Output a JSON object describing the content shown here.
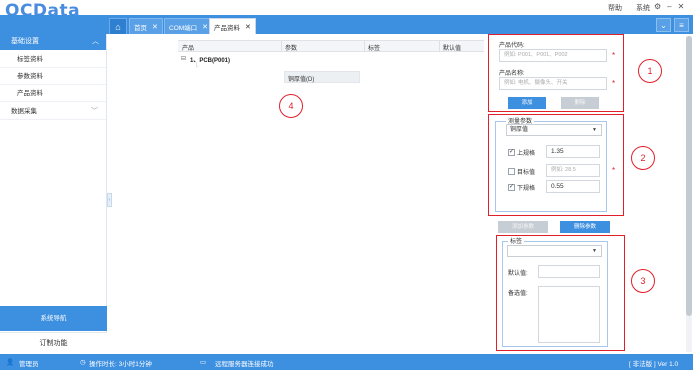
{
  "app": {
    "logo": "QCData",
    "top_links": [
      "帮助",
      "系统"
    ],
    "window_buttons": [
      "⚙",
      "–",
      "✕"
    ]
  },
  "tabs": [
    {
      "label": "首页",
      "active": false
    },
    {
      "label": "COM端口",
      "active": false
    },
    {
      "label": "产品资料",
      "active": true
    }
  ],
  "sidebar": {
    "group1": {
      "label": "基础设置",
      "items": [
        "标签资料",
        "参数资料",
        "产品资料"
      ]
    },
    "group2": {
      "label": "数据采集"
    },
    "bottom_primary": "系统导航",
    "bottom_secondary": "订制功能"
  },
  "grid": {
    "columns": [
      "产品",
      "参数",
      "标签",
      "默认值"
    ],
    "tree": {
      "expander": "⊟",
      "node": "1、PCB(P001)",
      "child_marker": "└",
      "child_param": "铜厚值(D)"
    }
  },
  "product_form": {
    "code_label": "产品代码:",
    "code_placeholder": "例如: P001、P001、P002",
    "name_label": "产品名称:",
    "name_placeholder": "例如: 电机、摄像头、开关",
    "add_button": "添加",
    "delete_button": "删除",
    "required_mark": "*"
  },
  "param_form": {
    "legend": "测量参数",
    "select_value": "铜厚值",
    "rows": [
      {
        "label": "上规格",
        "checked": true,
        "value": "1.35",
        "placeholder": ""
      },
      {
        "label": "目标值",
        "checked": false,
        "value": "",
        "placeholder": "例如: 28.5"
      },
      {
        "label": "下规格",
        "checked": true,
        "value": "0.55",
        "placeholder": ""
      }
    ],
    "add_param_button": "添加参数",
    "delete_param_button": "删除参数",
    "required_mark": "*"
  },
  "label_form": {
    "legend": "标签",
    "default_label": "默认值:",
    "options_label": "备选值:"
  },
  "annotations": [
    "1",
    "2",
    "3",
    "4"
  ],
  "statusbar": {
    "user": "管理员",
    "duration": "操作时长: 3小时1分钟",
    "service": "远程服务器连接成功",
    "version": "[ 非法版 ] Ver 1.0"
  },
  "colors": {
    "accent": "#3d8fe0",
    "annotation": "#e0202a"
  }
}
